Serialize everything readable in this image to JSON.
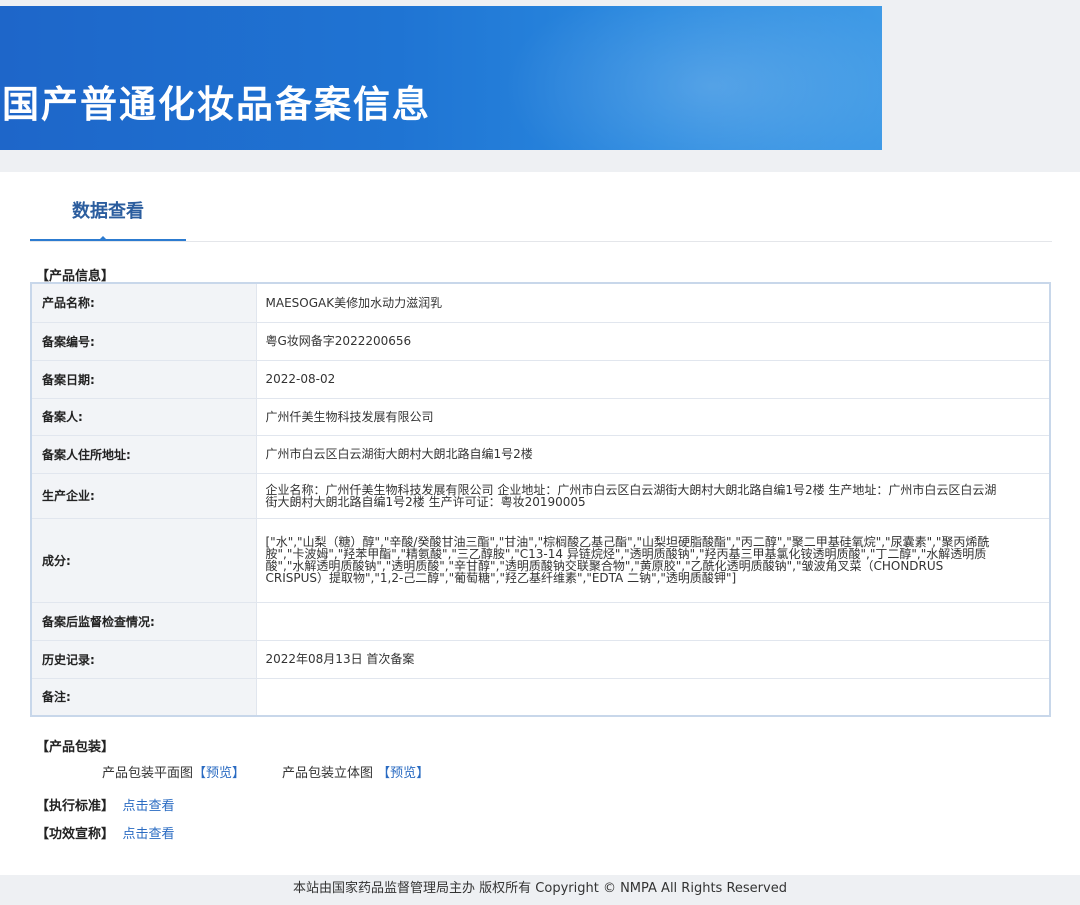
{
  "banner": {
    "title": "国产普通化妆品备案信息"
  },
  "tab": {
    "label": "数据查看"
  },
  "product_info": {
    "header": "【产品信息】",
    "rows": [
      {
        "key": "产品名称:",
        "value": "MAESOGAK美修加水动力滋润乳"
      },
      {
        "key": "备案编号:",
        "value": "粤G妆网备字2022200656"
      },
      {
        "key": "备案日期:",
        "value": "2022-08-02"
      },
      {
        "key": "备案人:",
        "value": "广州仟美生物科技发展有限公司"
      },
      {
        "key": "备案人住所地址:",
        "value": "广州市白云区白云湖街大朗村大朗北路自编1号2楼"
      },
      {
        "key": "生产企业:",
        "value": "企业名称：广州仟美生物科技发展有限公司 企业地址：广州市白云区白云湖街大朗村大朗北路自编1号2楼 生产地址：广州市白云区白云湖街大朗村大朗北路自编1号2楼 生产许可证：粤妆20190005"
      },
      {
        "key": "成分:",
        "value": "[\"水\",\"山梨（糖）醇\",\"辛酸/癸酸甘油三酯\",\"甘油\",\"棕榈酸乙基己酯\",\"山梨坦硬脂酸酯\",\"丙二醇\",\"聚二甲基硅氧烷\",\"尿囊素\",\"聚丙烯酰胺\",\"卡波姆\",\"羟苯甲酯\",\"精氨酸\",\"三乙醇胺\",\"C13-14 异链烷烃\",\"透明质酸钠\",\"羟丙基三甲基氯化铵透明质酸\",\"丁二醇\",\"水解透明质酸\",\"水解透明质酸钠\",\"透明质酸\",\"辛甘醇\",\"透明质酸钠交联聚合物\",\"黄原胶\",\"乙酰化透明质酸钠\",\"皱波角叉菜（CHONDRUS CRISPUS）提取物\",\"1,2-己二醇\",\"葡萄糖\",\"羟乙基纤维素\",\"EDTA 二钠\",\"透明质酸钾\"]"
      },
      {
        "key": "备案后监督检查情况:",
        "value": ""
      },
      {
        "key": "历史记录:",
        "value": "2022年08月13日 首次备案"
      },
      {
        "key": "备注:",
        "value": ""
      }
    ]
  },
  "packaging": {
    "header": "【产品包装】",
    "flat_label": "产品包装平面图",
    "flat_link": "预览",
    "solid_label": "产品包装立体图",
    "solid_link": "预览",
    "bracket_open": "【",
    "bracket_close": "】"
  },
  "standard": {
    "header": "【执行标准】",
    "link": "点击查看"
  },
  "efficacy": {
    "header": "【功效宣称】",
    "link": "点击查看"
  },
  "footer": {
    "text": "本站由国家药品监督管理局主办 版权所有 Copyright © NMPA All Rights Reserved"
  }
}
